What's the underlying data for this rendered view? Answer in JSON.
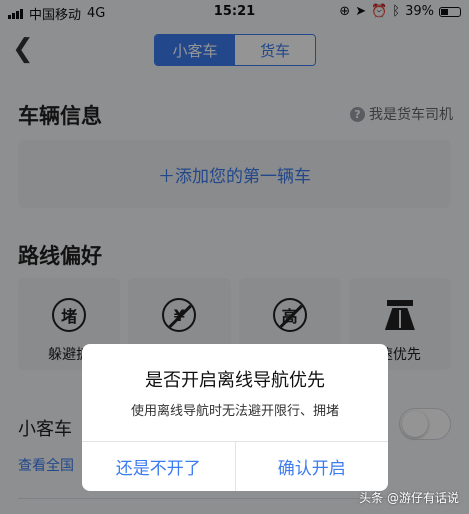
{
  "status_bar": {
    "carrier": "中国移动",
    "network": "4G",
    "time": "15:21",
    "battery": "39%"
  },
  "nav": {
    "tabs": [
      {
        "label": "小客车",
        "selected": true
      },
      {
        "label": "货车",
        "selected": false
      }
    ]
  },
  "vehicle": {
    "title": "车辆信息",
    "truck_driver_label": "我是货车司机",
    "add_vehicle": "＋添加您的第一辆车"
  },
  "route": {
    "title": "路线偏好",
    "options": [
      {
        "label": "躲避拥",
        "icon": "jam-icon",
        "glyph": "堵"
      },
      {
        "label": "",
        "icon": "no-toll-icon",
        "glyph": "¥"
      },
      {
        "label": "",
        "icon": "no-highway-icon",
        "glyph": "高"
      },
      {
        "label": "速优先",
        "icon": "highway-icon",
        "glyph": ""
      }
    ]
  },
  "car_row": {
    "label": "小客车",
    "link": "查看全国"
  },
  "dialog": {
    "title": "是否开启离线导航优先",
    "message": "使用离线导航时无法避开限行、拥堵",
    "cancel": "还是不开了",
    "confirm": "确认开启"
  },
  "watermark": "头条 @游仔有话说",
  "colors": {
    "accent": "#3b7cf0"
  }
}
